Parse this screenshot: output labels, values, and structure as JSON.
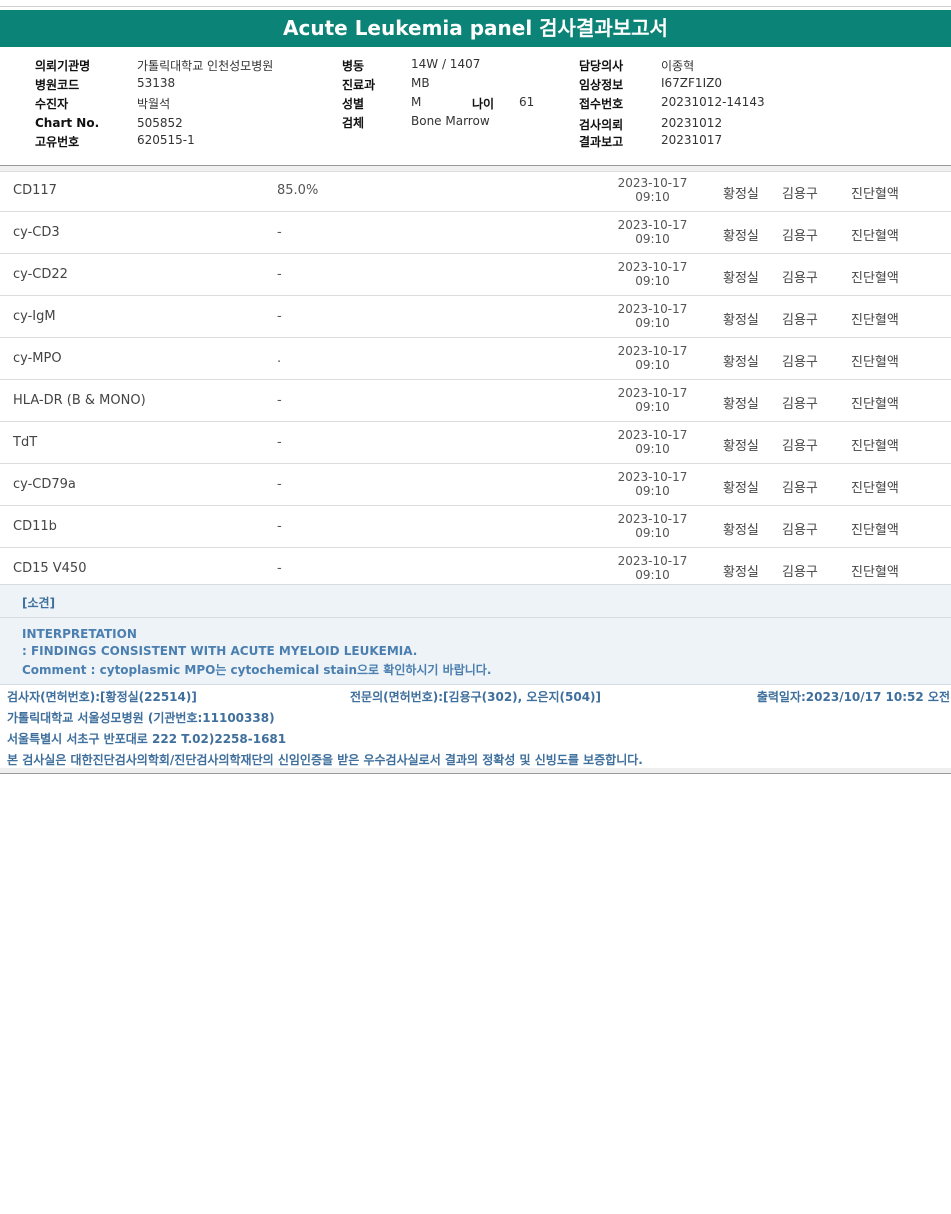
{
  "report": {
    "title": "Acute Leukemia panel 검사결과보고서"
  },
  "info": {
    "col1": [
      {
        "label": "의뢰기관명",
        "value": "가톨릭대학교 인천성모병원"
      },
      {
        "label": "병원코드",
        "value": "53138"
      },
      {
        "label": "수진자",
        "value": "박월석"
      },
      {
        "label": "Chart No.",
        "value": "505852"
      },
      {
        "label": "고유번호",
        "value": "620515-1"
      }
    ],
    "col2": [
      {
        "label": "병동",
        "value": "14W / 1407"
      },
      {
        "label": "진료과",
        "value": "MB"
      },
      {
        "label": "성별",
        "value": "M"
      },
      {
        "label": "검체",
        "value": "Bone Marrow"
      }
    ],
    "age": {
      "label": "나이",
      "value": "61"
    },
    "col3": [
      {
        "label": "담당의사",
        "value": "이종혁"
      },
      {
        "label": "임상정보",
        "value": "I67ZF1IZ0"
      },
      {
        "label": "접수번호",
        "value": "20231012-14143"
      },
      {
        "label": "검사의뢰",
        "value": "20231012"
      },
      {
        "label": "결과보고",
        "value": "20231017"
      }
    ]
  },
  "results": [
    {
      "name": "CD117",
      "result": "85.0%",
      "date": "2023-10-17",
      "time": "09:10",
      "tech": "황정실",
      "doctor": "김용구",
      "dept": "진단혈액"
    },
    {
      "name": "cy-CD3",
      "result": "-",
      "date": "2023-10-17",
      "time": "09:10",
      "tech": "황정실",
      "doctor": "김용구",
      "dept": "진단혈액"
    },
    {
      "name": "cy-CD22",
      "result": "-",
      "date": "2023-10-17",
      "time": "09:10",
      "tech": "황정실",
      "doctor": "김용구",
      "dept": "진단혈액"
    },
    {
      "name": "cy-IgM",
      "result": "-",
      "date": "2023-10-17",
      "time": "09:10",
      "tech": "황정실",
      "doctor": "김용구",
      "dept": "진단혈액"
    },
    {
      "name": "cy-MPO",
      "result": ".",
      "date": "2023-10-17",
      "time": "09:10",
      "tech": "황정실",
      "doctor": "김용구",
      "dept": "진단혈액"
    },
    {
      "name": "HLA-DR (B & MONO)",
      "result": "-",
      "date": "2023-10-17",
      "time": "09:10",
      "tech": "황정실",
      "doctor": "김용구",
      "dept": "진단혈액"
    },
    {
      "name": "TdT",
      "result": "-",
      "date": "2023-10-17",
      "time": "09:10",
      "tech": "황정실",
      "doctor": "김용구",
      "dept": "진단혈액"
    },
    {
      "name": "cy-CD79a",
      "result": "-",
      "date": "2023-10-17",
      "time": "09:10",
      "tech": "황정실",
      "doctor": "김용구",
      "dept": "진단혈액"
    },
    {
      "name": "CD11b",
      "result": "-",
      "date": "2023-10-17",
      "time": "09:10",
      "tech": "황정실",
      "doctor": "김용구",
      "dept": "진단혈액"
    },
    {
      "name": "CD15 V450",
      "result": "-",
      "date": "2023-10-17",
      "time": "09:10",
      "tech": "황정실",
      "doctor": "김용구",
      "dept": "진단혈액"
    }
  ],
  "remarks": {
    "header": "[소견]",
    "lines": [
      "INTERPRETATION",
      ": FINDINGS CONSISTENT WITH ACUTE MYELOID LEUKEMIA.",
      "Comment : cytoplasmic MPO는 cytochemical stain으로 확인하시기 바랍니다."
    ]
  },
  "footer": {
    "tester": "검사자(면허번호):[황정실(22514)]",
    "specialist": "전문의(면허번호):[김용구(302), 오은지(504)]",
    "printed": "출력일자:2023/10/17 10:52 오전",
    "institution": "가톨릭대학교 서울성모병원 (기관번호:11100338)",
    "address": "서울특별시 서초구 반포대로 222 T.02)2258-1681",
    "certification": "본 검사실은 대한진단검사의학회/진단검사의학재단의 신임인증을 받은 우수검사실로서 결과의 정확성 및 신빙도를 보증합니다."
  }
}
